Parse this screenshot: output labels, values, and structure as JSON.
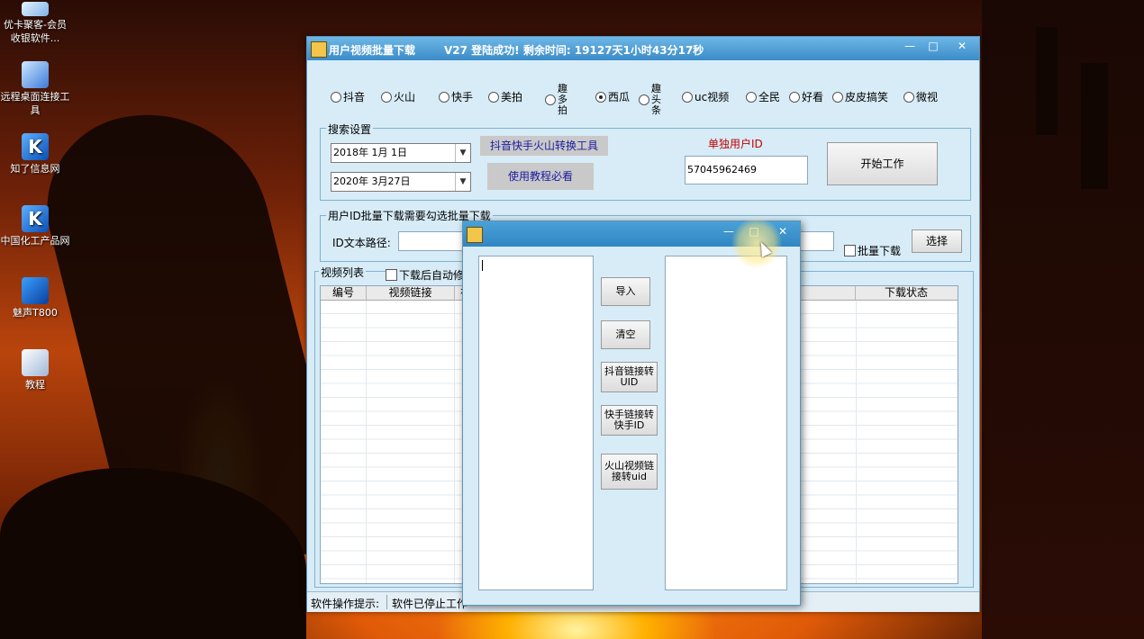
{
  "desktop": {
    "icons": [
      {
        "label": "优卡聚客-会员收银软件...",
        "icon": "app-icon"
      },
      {
        "label": "远程桌面连接工具",
        "icon": "remote-desktop-icon"
      },
      {
        "label": "知了信息网",
        "icon": "k-app-icon"
      },
      {
        "label": "中国化工产品网",
        "icon": "k-app-icon"
      },
      {
        "label": "魅声T800",
        "icon": "audio-wave-icon"
      },
      {
        "label": "教程",
        "icon": "file-shortcut-icon"
      }
    ]
  },
  "main_window": {
    "title": "用户视频批量下载",
    "status": "V27  登陆成功! 剩余时间: 19127天1小时43分17秒",
    "controls": {
      "minimize": "—",
      "maximize": "□",
      "close": "✕"
    },
    "platforms": [
      {
        "label": "抖音",
        "selected": false
      },
      {
        "label": "火山",
        "selected": false
      },
      {
        "label": "快手",
        "selected": false
      },
      {
        "label": "美拍",
        "selected": false
      },
      {
        "label": "趣多拍",
        "selected": false
      },
      {
        "label": "西瓜",
        "selected": true
      },
      {
        "label": "趣头条",
        "selected": false
      },
      {
        "label": "uc视频",
        "selected": false
      },
      {
        "label": "全民",
        "selected": false
      },
      {
        "label": "好看",
        "selected": false
      },
      {
        "label": "皮皮搞笑",
        "selected": false
      },
      {
        "label": "微视",
        "selected": false
      }
    ],
    "search": {
      "group_title": "搜索设置",
      "start_date": "2018年 1月 1日",
      "end_date": "2020年 3月27日",
      "convert_tool_button": "抖音快手火山转换工具",
      "tutorial_button": "使用教程必看",
      "single_user_label": "单独用户ID",
      "single_user_value": "57045962469",
      "start_button": "开始工作"
    },
    "batch": {
      "group_title": "用户ID批量下载需要勾选批量下载",
      "path_label": "ID文本路径:",
      "batch_checkbox": "批量下载",
      "choose_button": "选择"
    },
    "video_list": {
      "group_title": "视频列表",
      "auto_checkbox": "下载后自动修",
      "columns": {
        "id": "编号",
        "link": "视频链接",
        "link2_partial": "视",
        "status": "下载状态"
      }
    },
    "statusbar": {
      "hint_label": "软件操作提示:",
      "hint_value": "软件已停止工作"
    }
  },
  "dialog": {
    "controls": {
      "minimize": "—",
      "maximize": "□",
      "close": "✕"
    },
    "buttons": {
      "import": "导入",
      "clear": "清空",
      "douyin_convert": "抖音链接转UID",
      "kuaishou_convert": "快手链接转快手ID",
      "huoshan_convert": "火山视频链接转uid"
    }
  }
}
